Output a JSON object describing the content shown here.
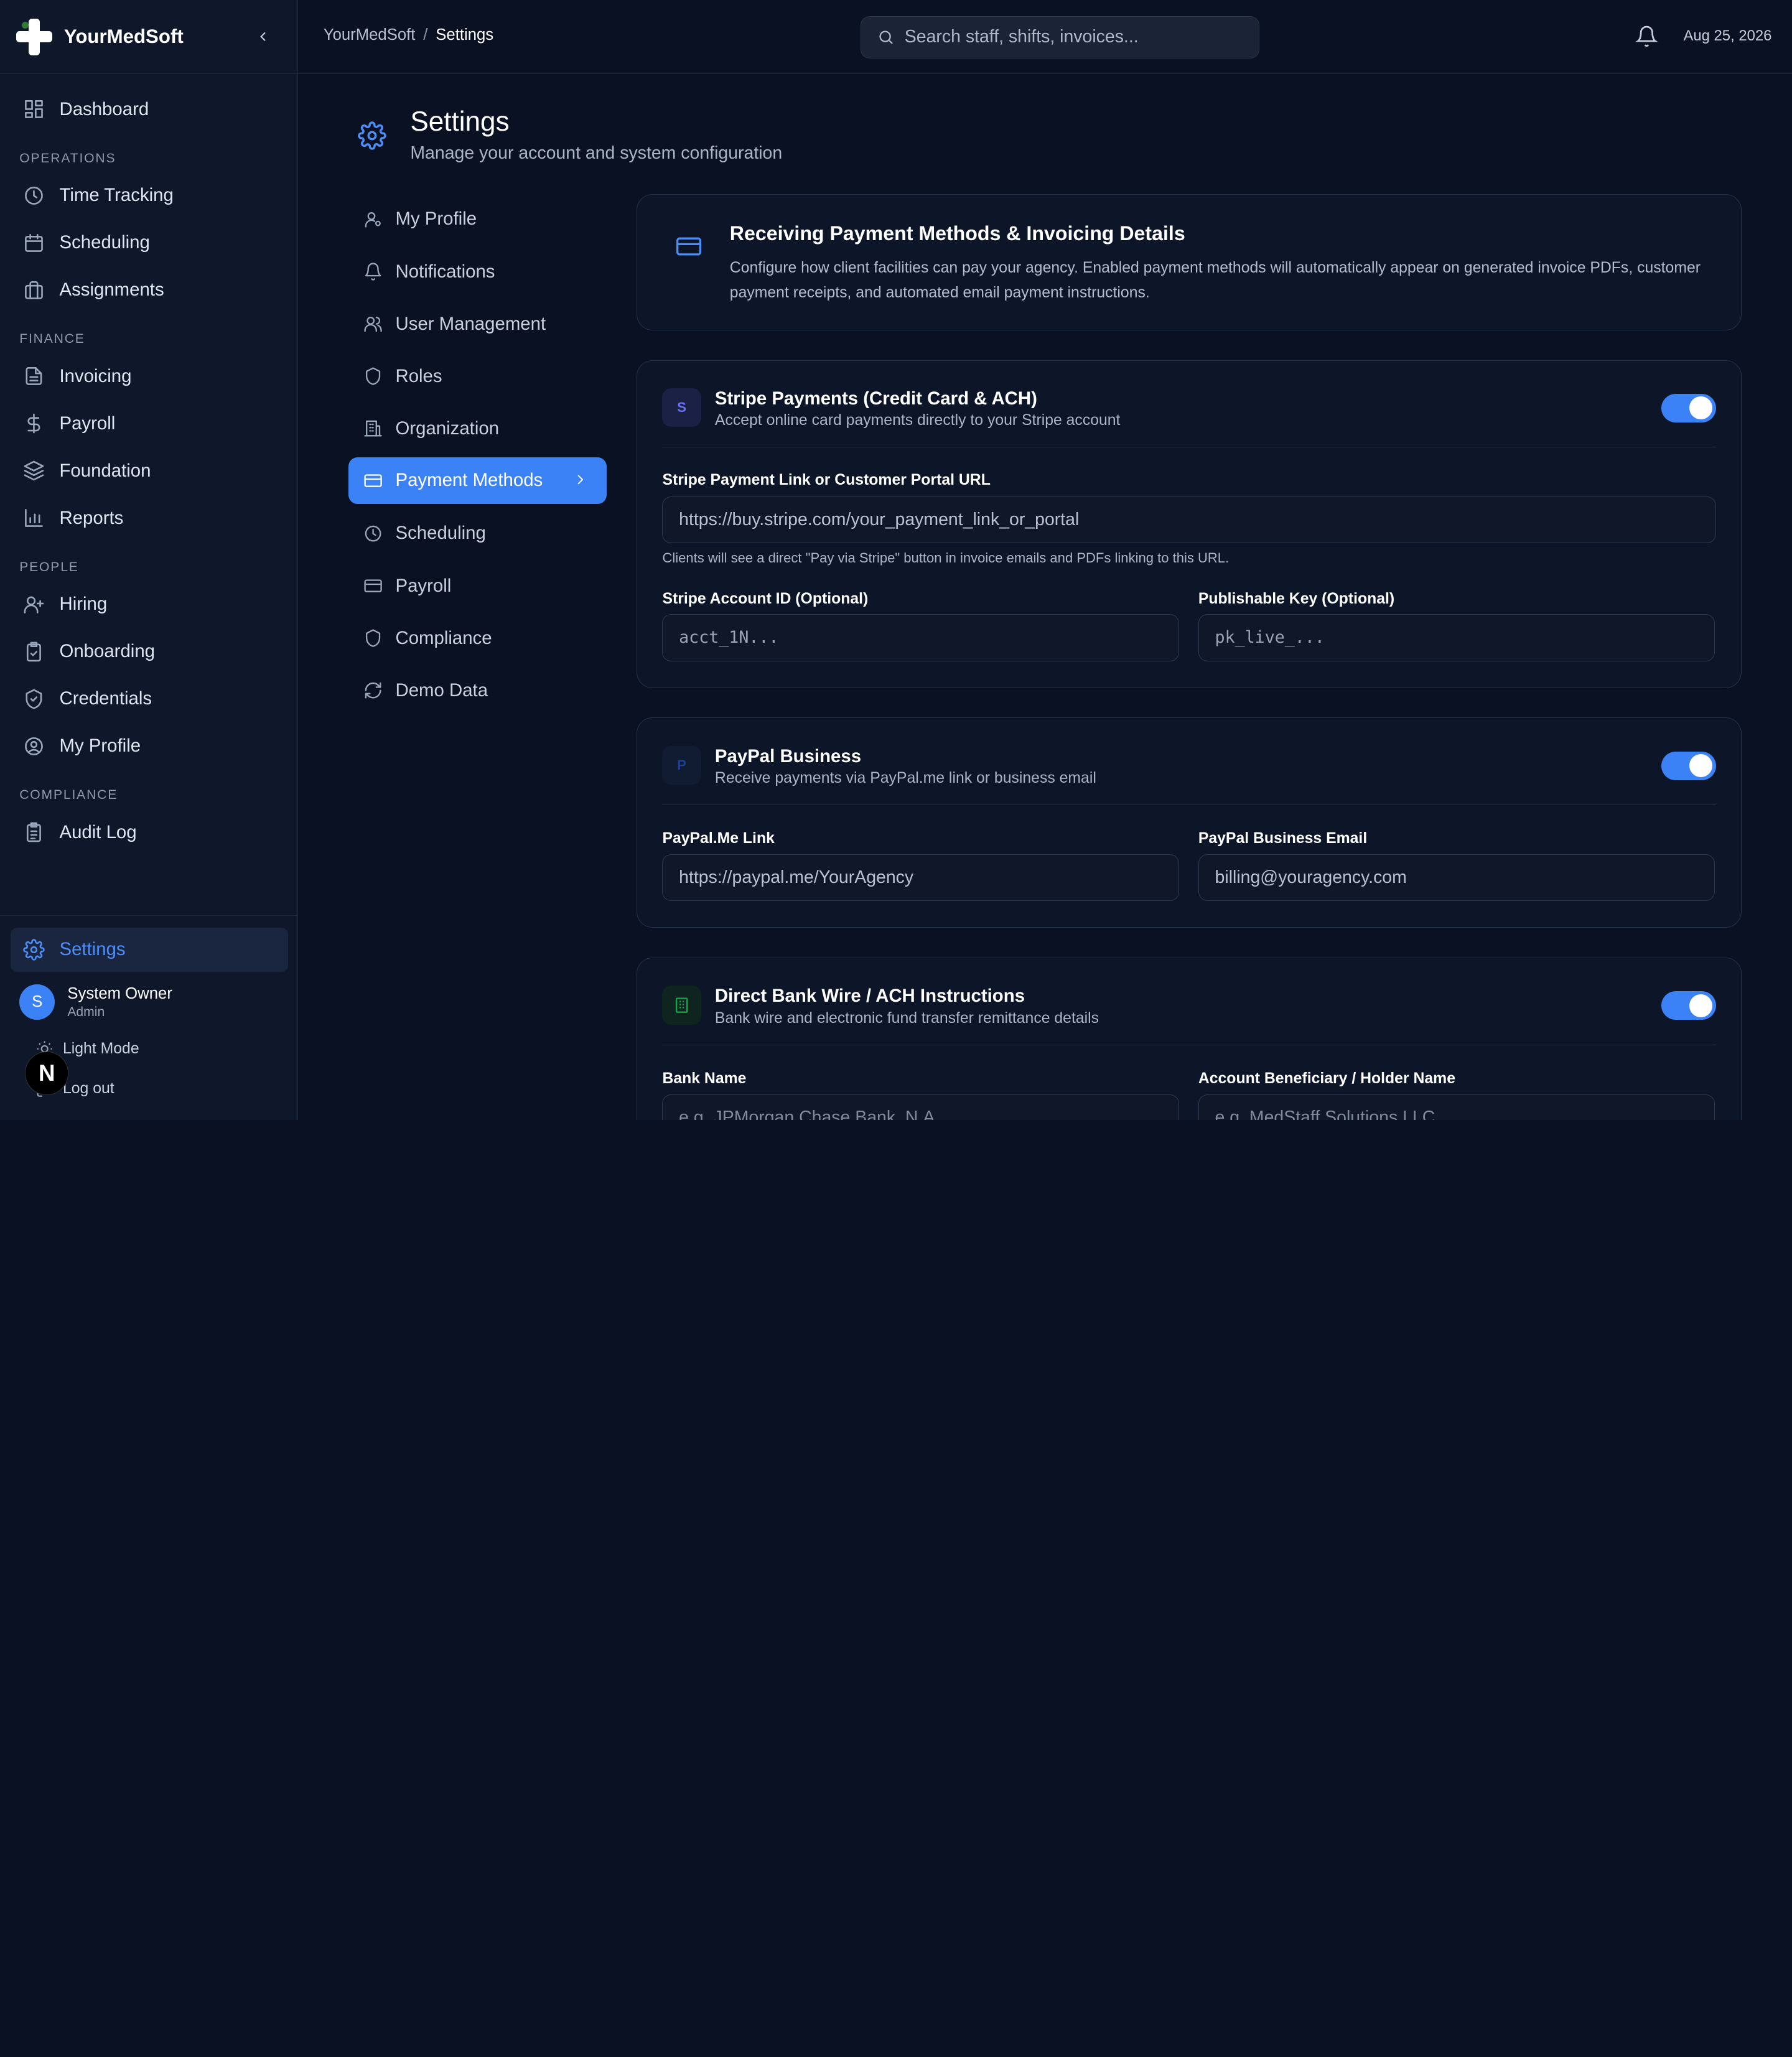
{
  "brand": {
    "name": "YourMedSoft"
  },
  "sidebar": {
    "dashboard": "Dashboard",
    "sections": {
      "operations": "OPERATIONS",
      "finance": "FINANCE",
      "people": "PEOPLE",
      "compliance": "COMPLIANCE"
    },
    "items": {
      "time_tracking": "Time Tracking",
      "scheduling": "Scheduling",
      "assignments": "Assignments",
      "invoicing": "Invoicing",
      "payroll": "Payroll",
      "foundation": "Foundation",
      "reports": "Reports",
      "hiring": "Hiring",
      "onboarding": "Onboarding",
      "credentials": "Credentials",
      "my_profile": "My Profile",
      "audit_log": "Audit Log"
    },
    "settings": "Settings",
    "user": {
      "initial": "S",
      "name": "System Owner",
      "role": "Admin"
    },
    "light_mode": "Light Mode",
    "logout": "Log out",
    "badge": "N"
  },
  "topbar": {
    "breadcrumb_root": "YourMedSoft",
    "breadcrumb_sep": "/",
    "breadcrumb_current": "Settings",
    "search_placeholder": "Search staff, shifts, invoices...",
    "date": "Aug 25, 2026"
  },
  "page": {
    "title": "Settings",
    "subtitle": "Manage your account and system configuration"
  },
  "settings_nav": {
    "my_profile": "My Profile",
    "notifications": "Notifications",
    "user_management": "User Management",
    "roles": "Roles",
    "organization": "Organization",
    "payment_methods": "Payment Methods",
    "scheduling": "Scheduling",
    "payroll": "Payroll",
    "compliance": "Compliance",
    "demo_data": "Demo Data"
  },
  "intro": {
    "title": "Receiving Payment Methods & Invoicing Details",
    "desc_line1": "Configure how client facilities can pay your agency. Enabled payment methods will automatically appear on generated invoice PDFs, customer",
    "desc_line2": "payment receipts, and automated email payment instructions."
  },
  "stripe": {
    "badge": "S",
    "title": "Stripe Payments (Credit Card & ACH)",
    "subtitle": "Accept online card payments directly to your Stripe account",
    "enabled": true,
    "link_label": "Stripe Payment Link or Customer Portal URL",
    "link_placeholder": "https://buy.stripe.com/your_payment_link_or_portal",
    "link_hint": "Clients will see a direct \"Pay via Stripe\" button in invoice emails and PDFs linking to this URL.",
    "account_label": "Stripe Account ID (Optional)",
    "account_placeholder": "acct_1N...",
    "key_label": "Publishable Key (Optional)",
    "key_placeholder": "pk_live_..."
  },
  "paypal": {
    "badge": "P",
    "title": "PayPal Business",
    "subtitle": "Receive payments via PayPal.me link or business email",
    "enabled": true,
    "link_label": "PayPal.Me Link",
    "link_placeholder": "https://paypal.me/YourAgency",
    "email_label": "PayPal Business Email",
    "email_placeholder": "billing@youragency.com"
  },
  "bank": {
    "title": "Direct Bank Wire / ACH Instructions",
    "subtitle": "Bank wire and electronic fund transfer remittance details",
    "enabled": true,
    "bank_label": "Bank Name",
    "bank_placeholder": "e.g. JPMorgan Chase Bank, N.A.",
    "holder_label": "Account Beneficiary / Holder Name",
    "holder_placeholder": "e.g. MedStaff Solutions LLC"
  },
  "colors": {
    "accent": "#3b82f6",
    "background": "#0a1122",
    "sidebar": "#0f182b"
  }
}
